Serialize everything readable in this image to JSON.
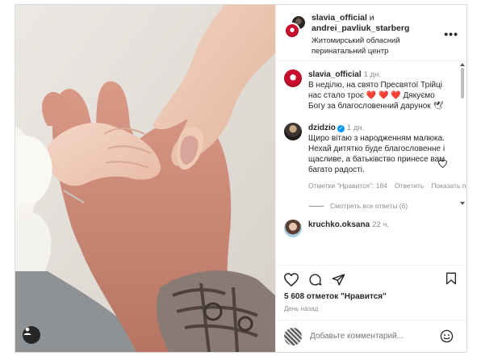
{
  "post": {
    "header": {
      "user1": "slavia_official",
      "and_word": "и",
      "user2": "andrei_pavliuk_starberg",
      "location": "Житомирський обласний перинатальний центр",
      "more": "•••"
    },
    "caption": {
      "username": "slavia_official",
      "time": "1 дн.",
      "text": "В неділю, на свято Пресвятої Трійці нас стало троє",
      "hearts": "❤️ ❤️ ❤️",
      "text2": "Дякуємо Богу за благословенний дарунок 🕊"
    },
    "comment": {
      "username": "dzidzio",
      "verified": "✓",
      "time": "1 дн.",
      "text_line1": "Щиро вітаю з народженням малюка.",
      "text_line2": "Нехай дитятко буде благословенне і щасливе, а батьківство принесе вам багато радості.",
      "likes": "Отметки \"Нравится\": 184",
      "reply": "Ответить",
      "translate": "Показать пере"
    },
    "view_replies": "Смотреть все ответы (6)",
    "next_comment": {
      "username": "kruchko.oksana",
      "time": "22 ч."
    },
    "likes_count": "5 608 отметок \"Нравится\"",
    "date": "День назад",
    "add_comment_placeholder": "Добавьте комментарий...",
    "colors": {
      "accent": "#0095f6",
      "heart": "#ed4956",
      "muted": "#8e8e8e",
      "text": "#262626",
      "border": "#dbdbdb"
    },
    "icons": [
      "heart-icon",
      "comment-icon",
      "share-icon",
      "bookmark-icon",
      "emoji-icon",
      "user-tag-icon"
    ]
  }
}
